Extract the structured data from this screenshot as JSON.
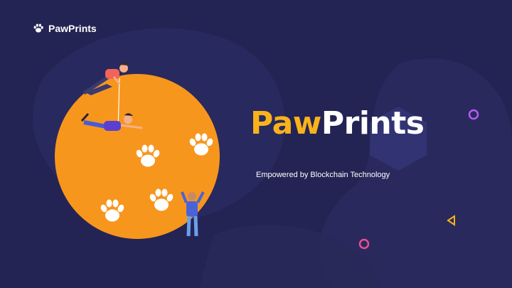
{
  "brand": {
    "name": "PawPrints",
    "icon": "paw-icon"
  },
  "hero": {
    "title_accent": "Paw",
    "title_rest": "Prints",
    "tagline": "Empowered by Blockchain Technology"
  },
  "colors": {
    "background": "#232454",
    "circle": "#f7961d",
    "accent": "#f9b21b",
    "ring_purple": "#b45cf0",
    "ring_pink": "#e8508f",
    "triangle": "#f9b21b"
  }
}
